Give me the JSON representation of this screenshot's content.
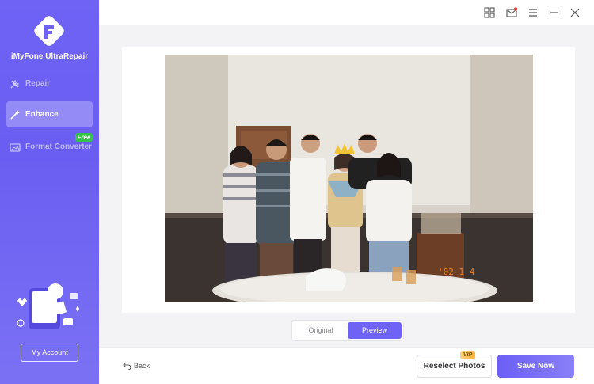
{
  "app": {
    "brand": "iMyFone UltraRepair"
  },
  "sidebar": {
    "items": [
      {
        "label": "Repair",
        "icon": "tools-icon",
        "active": false
      },
      {
        "label": "Enhance",
        "icon": "magic-wand-icon",
        "active": true
      },
      {
        "label": "Format Converter",
        "icon": "image-convert-icon",
        "active": false,
        "badge": "Free"
      }
    ],
    "account_label": "My Account"
  },
  "topbar": {
    "icons": [
      "grid-icon",
      "mail-icon",
      "menu-icon",
      "minimize-icon",
      "close-icon"
    ]
  },
  "preview": {
    "toggle": {
      "original_label": "Original",
      "preview_label": "Preview",
      "selected": "Preview"
    },
    "photo_stamp": "'02 1 4"
  },
  "bottom": {
    "back_label": "Back",
    "reselect_label": "Reselect Photos",
    "save_label": "Save Now",
    "vip_badge": "VIP"
  },
  "colors": {
    "accent": "#6f63f6",
    "free": "#34c24a",
    "vip": "#f6b23c"
  }
}
